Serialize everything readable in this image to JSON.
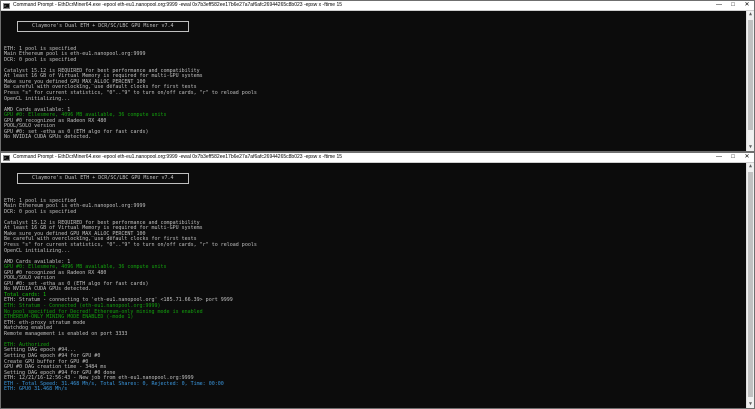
{
  "windows": [
    {
      "title": "Command Prompt - EthDcrMiner64.exe  -epool eth-eu1.nanopool.org:9999 -ewal 0x7b3eff582ee17b6e27a7af6afc26944265c8b023 -epsw x -ftime 15",
      "banner": "Claymore's Dual ETH + DCR/SC/LBC GPU Miner v7.4",
      "lines": [
        {
          "text": "",
          "color": "default"
        },
        {
          "text": "ETH: 1 pool is specified",
          "color": "default"
        },
        {
          "text": "Main Ethereum pool is eth-eu1.nanopool.org:9999",
          "color": "default"
        },
        {
          "text": "DCR: 0 pool is specified",
          "color": "default"
        },
        {
          "text": "",
          "color": "default"
        },
        {
          "text": "Catalyst 15.12 is REQUIRED for best performance and compatibility",
          "color": "default"
        },
        {
          "text": "At least 16 GB of Virtual Memory is required for multi-GPU systems",
          "color": "default"
        },
        {
          "text": "Make sure you defined GPU_MAX_ALLOC_PERCENT 100",
          "color": "default"
        },
        {
          "text": "Be careful with overclocking, use default clocks for first tests",
          "color": "default"
        },
        {
          "text": "Press \"s\" for current statistics, \"0\"..\"9\" to turn on/off cards, \"r\" to reload pools",
          "color": "default"
        },
        {
          "text": "OpenCL initializing...",
          "color": "default"
        },
        {
          "text": "",
          "color": "default"
        },
        {
          "text": "AMD Cards available: 1",
          "color": "default"
        },
        {
          "text": "GPU #0: Ellesmere, 4096 MB available, 36 compute units",
          "color": "green"
        },
        {
          "text": "GPU #0 recognized as Radeon RX 480",
          "color": "default"
        },
        {
          "text": "POOL/SOLO version",
          "color": "default"
        },
        {
          "text": "GPU #0: set -etha as 0 (ETH algo for fast cards)",
          "color": "default"
        },
        {
          "text": "No NVIDIA CUDA GPUs detected.",
          "color": "default"
        }
      ]
    },
    {
      "title": "Command Prompt - EthDcrMiner64.exe  -epool eth-eu1.nanopool.org:9999 -ewal 0x7b3eff582ee17b6e27a7af6afc26944265c8b023 -epsw x -ftime 15",
      "banner": "Claymore's Dual ETH + DCR/SC/LBC GPU Miner v7.4",
      "lines": [
        {
          "text": "",
          "color": "default"
        },
        {
          "text": "ETH: 1 pool is specified",
          "color": "default"
        },
        {
          "text": "Main Ethereum pool is eth-eu1.nanopool.org:9999",
          "color": "default"
        },
        {
          "text": "DCR: 0 pool is specified",
          "color": "default"
        },
        {
          "text": "",
          "color": "default"
        },
        {
          "text": "Catalyst 15.12 is REQUIRED for best performance and compatibility",
          "color": "default"
        },
        {
          "text": "At least 16 GB of Virtual Memory is required for multi-GPU systems",
          "color": "default"
        },
        {
          "text": "Make sure you defined GPU_MAX_ALLOC_PERCENT 100",
          "color": "default"
        },
        {
          "text": "Be careful with overclocking, use default clocks for first tests",
          "color": "default"
        },
        {
          "text": "Press \"s\" for current statistics, \"0\"..\"9\" to turn on/off cards, \"r\" to reload pools",
          "color": "default"
        },
        {
          "text": "OpenCL initializing...",
          "color": "default"
        },
        {
          "text": "",
          "color": "default"
        },
        {
          "text": "AMD Cards available: 1",
          "color": "default"
        },
        {
          "text": "GPU #0: Ellesmere, 4096 MB available, 36 compute units",
          "color": "green"
        },
        {
          "text": "GPU #0 recognized as Radeon RX 480",
          "color": "default"
        },
        {
          "text": "POOL/SOLO version",
          "color": "default"
        },
        {
          "text": "GPU #0: set -etha as 0 (ETH algo for fast cards)",
          "color": "default"
        },
        {
          "text": "No NVIDIA CUDA GPUs detected.",
          "color": "default"
        },
        {
          "text": "Total cards: 1",
          "color": "brightgreen"
        },
        {
          "text": "ETH: Stratum - connecting to 'eth-eu1.nanopool.org' <185.71.66.39> port 9999",
          "color": "default"
        },
        {
          "text": "ETH: Stratum - Connected (eth-eu1.nanopool.org:9999)",
          "color": "green"
        },
        {
          "text": "No pool specified for Decred! Ethereum-only mining mode is enabled",
          "color": "green"
        },
        {
          "text": "ETHEREUM-ONLY MINING MODE ENABLED (-mode 1)",
          "color": "green"
        },
        {
          "text": "ETH: eth-proxy stratum mode",
          "color": "default"
        },
        {
          "text": "Watchdog enabled",
          "color": "default"
        },
        {
          "text": "Remote management is enabled on port 3333",
          "color": "default"
        },
        {
          "text": "",
          "color": "default"
        },
        {
          "text": "ETH: Authorized",
          "color": "green"
        },
        {
          "text": "Setting DAG epoch #94...",
          "color": "default"
        },
        {
          "text": "Setting DAG epoch #94 for GPU #0",
          "color": "default"
        },
        {
          "text": "Create GPU buffer for GPU #0",
          "color": "default"
        },
        {
          "text": "GPU #0 DAG creation time - 3484 ms",
          "color": "default"
        },
        {
          "text": "Setting DAG epoch #94 for GPU #0 done",
          "color": "default"
        },
        {
          "text": "ETH: 12/21/16-12:56:43 - New job from eth-eu1.nanopool.org:9999",
          "color": "default"
        },
        {
          "text": "ETH - Total Speed: 31.468 Mh/s, Total Shares: 0, Rejected: 0, Time: 00:00",
          "color": "cyan"
        },
        {
          "text": "ETH: GPU0 31.468 Mh/s",
          "color": "cyan"
        }
      ]
    }
  ],
  "controls": {
    "minimize": "—",
    "maximize": "□",
    "close": "✕"
  },
  "scroll": {
    "up": "▲",
    "down": "▼"
  }
}
